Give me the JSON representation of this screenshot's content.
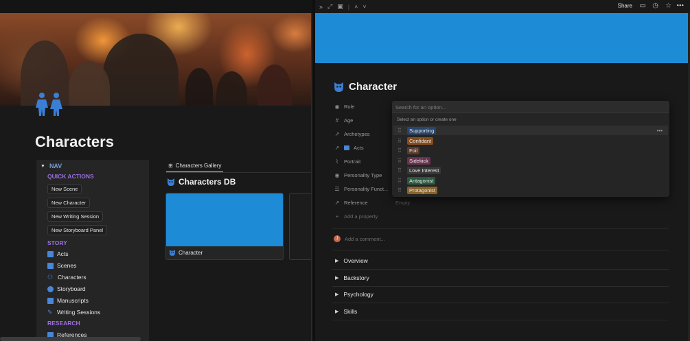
{
  "left": {
    "page_title": "Characters",
    "nav": {
      "heading": "NAV",
      "quick_actions_label": "QUICK ACTIONS",
      "buttons": [
        "New Scene",
        "New Character",
        "New Writing Session",
        "New Storyboard Panel"
      ],
      "story_label": "STORY",
      "story_links": [
        {
          "label": "Acts",
          "icon": "acts-icon"
        },
        {
          "label": "Scenes",
          "icon": "camera-icon"
        },
        {
          "label": "Characters",
          "icon": "people-icon"
        },
        {
          "label": "Storyboard",
          "icon": "storyboard-icon"
        },
        {
          "label": "Manuscripts",
          "icon": "book-icon"
        },
        {
          "label": "Writing Sessions",
          "icon": "pen-icon"
        }
      ],
      "research_label": "RESEARCH",
      "research_links": [
        {
          "label": "References",
          "icon": "briefcase-icon"
        }
      ]
    },
    "gallery_tab": "Characters Gallery",
    "db_title": "Characters DB",
    "card_label": "Character"
  },
  "right": {
    "share_label": "Share",
    "title": "Character",
    "properties": [
      {
        "label": "Role",
        "icon": "circle-arrow-icon"
      },
      {
        "label": "Age",
        "icon": "hash-icon"
      },
      {
        "label": "Archetypes",
        "icon": "relation-icon"
      },
      {
        "label": "Acts",
        "icon": "relation-icon"
      },
      {
        "label": "Portrait",
        "icon": "paperclip-icon"
      },
      {
        "label": "Personality Type",
        "icon": "circle-arrow-icon"
      },
      {
        "label": "Personality Funct...",
        "icon": "list-icon"
      },
      {
        "label": "Reference",
        "icon": "relation-icon"
      }
    ],
    "reference_value": "Empty",
    "add_property": "Add a property",
    "dropdown": {
      "placeholder": "Search for an option...",
      "hint": "Select an option or create one",
      "options": [
        {
          "label": "Supporting",
          "color": "#28456c"
        },
        {
          "label": "Confidant",
          "color": "#854c1d"
        },
        {
          "label": "Foil",
          "color": "#5a3a2a"
        },
        {
          "label": "Sidekick",
          "color": "#69314c"
        },
        {
          "label": "Love Interest",
          "color": "#373737"
        },
        {
          "label": "Antagonist",
          "color": "#2b593f"
        },
        {
          "label": "Protagonist",
          "color": "#89632a"
        }
      ]
    },
    "comment_placeholder": "Add a comment...",
    "avatar_initial": "J",
    "toggles": [
      "Overview",
      "Backstory",
      "Psychology",
      "Skills"
    ]
  },
  "colors": {
    "accent": "#1d8bd6",
    "nav_purple": "#9b6fe0",
    "nav_blue": "#6f9fd8"
  }
}
